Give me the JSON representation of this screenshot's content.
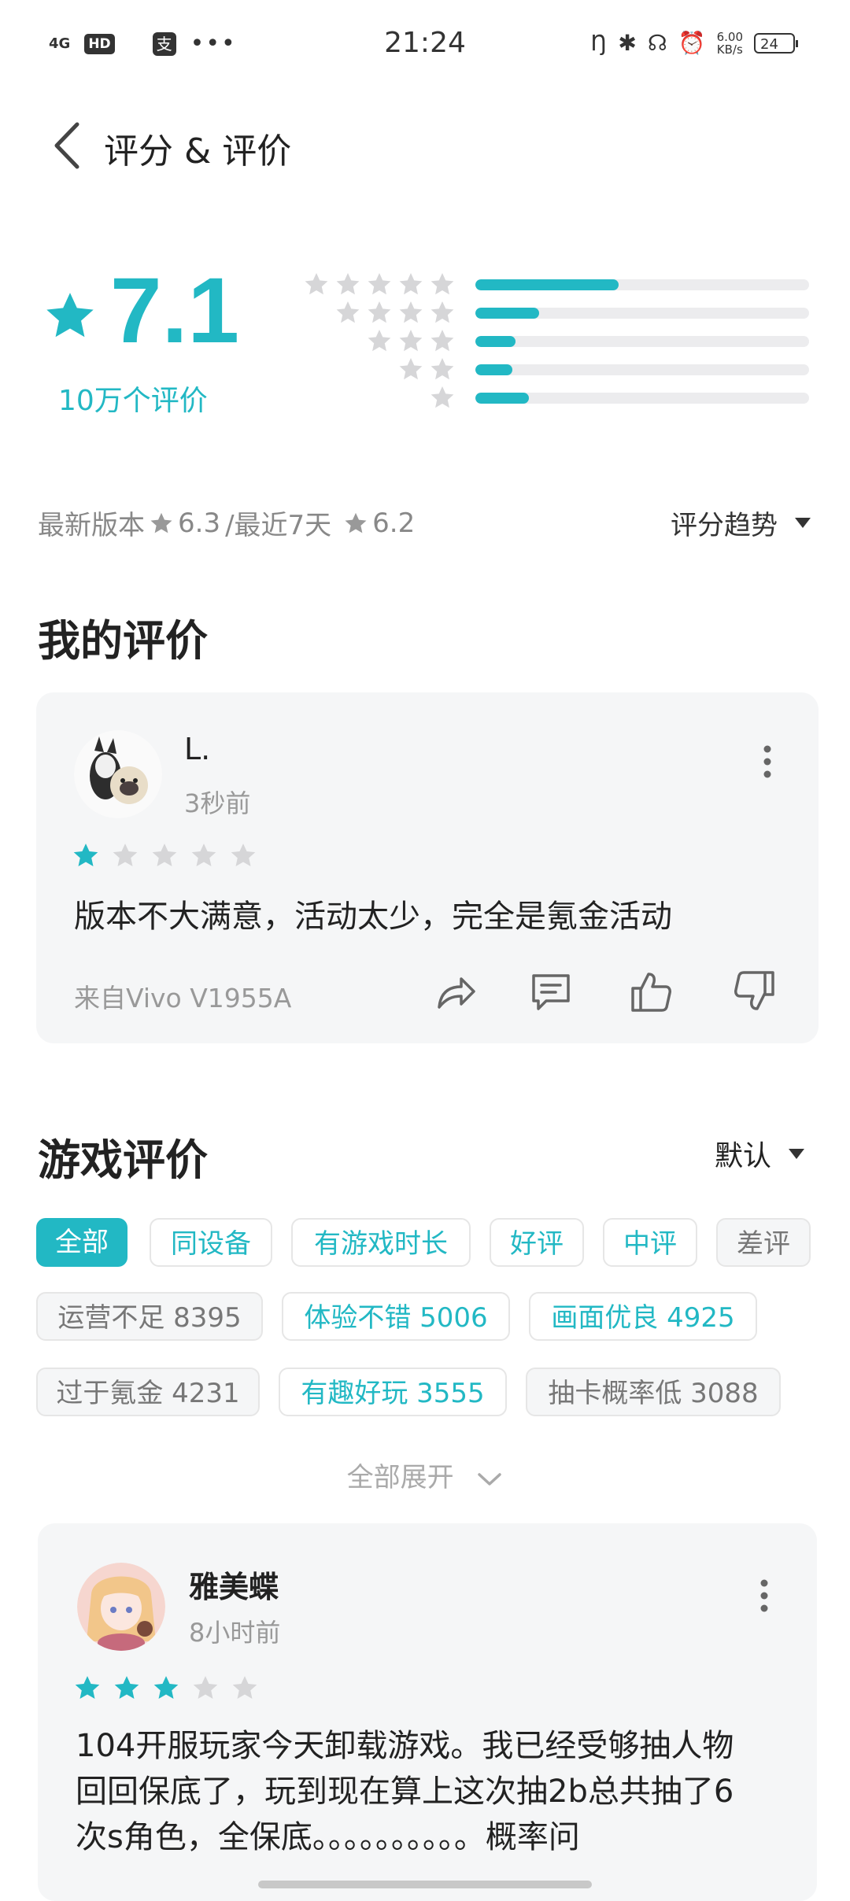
{
  "status_bar": {
    "network": "4G",
    "hd": "HD",
    "alipay": "支",
    "more": "•••",
    "time": "21:24",
    "speed_value": "6.00",
    "speed_unit": "KB/s",
    "battery": "24"
  },
  "header": {
    "title": "评分 & 评价"
  },
  "rating": {
    "score": "7.1",
    "count": "10万个评价",
    "distribution": [
      0.43,
      0.19,
      0.12,
      0.11,
      0.16
    ]
  },
  "version_line": {
    "latest_label": "最新版本",
    "latest_score": "6.3",
    "recent_label": "/最近7天",
    "recent_score": "6.2",
    "trend_label": "评分趋势"
  },
  "my_review": {
    "heading": "我的评价",
    "user": "L.",
    "time": "3秒前",
    "stars": 1,
    "text": "版本不大满意，活动太少，完全是氪金活动",
    "device": "来自Vivo V1955A"
  },
  "game_reviews": {
    "heading": "游戏评价",
    "sort": "默认",
    "filters": [
      "全部",
      "同设备",
      "有游戏时长",
      "好评",
      "中评",
      "差评"
    ],
    "tags": [
      {
        "label": "运营不足 8395",
        "tone": "neg"
      },
      {
        "label": "体验不错 5006",
        "tone": "pos"
      },
      {
        "label": "画面优良 4925",
        "tone": "pos"
      },
      {
        "label": "过于氪金 4231",
        "tone": "neg"
      },
      {
        "label": "有趣好玩 3555",
        "tone": "pos"
      },
      {
        "label": "抽卡概率低 3088",
        "tone": "neg"
      }
    ],
    "expand": "全部展开"
  },
  "review1": {
    "user": "雅美蝶",
    "time": "8小时前",
    "stars": 3,
    "line1": "104开服玩家今天卸载游戏。我已经受够抽人物",
    "line2": "回回保底了，玩到现在算上这次抽2b总共抽了6",
    "line3": "次s角色，全保底。。。。。。。。。。概率问"
  },
  "colors": {
    "accent": "#22b8c4",
    "star_empty": "#d6d6d8",
    "card_bg": "#f5f6f7"
  },
  "icons": [
    "back-icon",
    "star-icon",
    "more-icon",
    "share-icon",
    "comment-icon",
    "thumbs-up-icon",
    "thumbs-down-icon",
    "chevron-down-icon"
  ]
}
